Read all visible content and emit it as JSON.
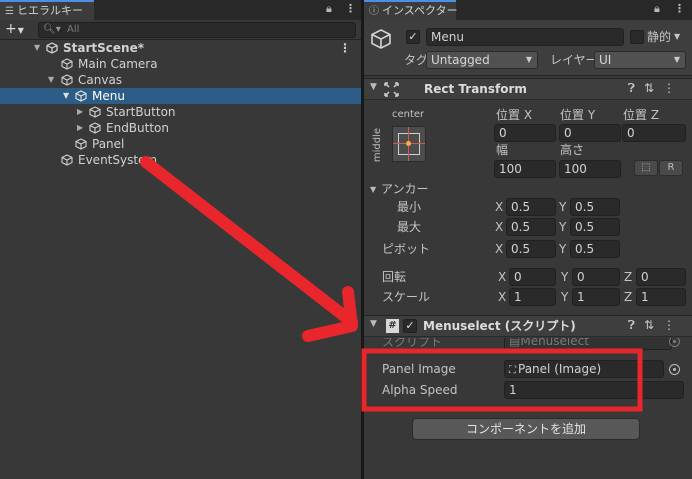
{
  "hierarchy": {
    "tab_label": "ヒエラルキー",
    "search_placeholder": "All",
    "add_label": "+",
    "items": [
      {
        "label": "StartScene*"
      },
      {
        "label": "Main Camera"
      },
      {
        "label": "Canvas"
      },
      {
        "label": "Menu"
      },
      {
        "label": "StartButton"
      },
      {
        "label": "EndButton"
      },
      {
        "label": "Panel"
      },
      {
        "label": "EventSystem"
      }
    ]
  },
  "inspector": {
    "tab_label": "インスペクター",
    "object": {
      "name": "Menu",
      "static_label": "静的",
      "tag_label": "タグ",
      "tag_value": "Untagged",
      "layer_label": "レイヤー",
      "layer_value": "UI"
    },
    "rect_transform": {
      "title": "Rect Transform",
      "anchor_h_label": "center",
      "anchor_v_label": "middle",
      "pos_x_label": "位置 X",
      "pos_y_label": "位置 Y",
      "pos_z_label": "位置 Z",
      "pos_x": "0",
      "pos_y": "0",
      "pos_z": "0",
      "width_label": "幅",
      "height_label": "高さ",
      "width": "100",
      "height": "100",
      "raw_button": "R",
      "anchors_label": "アンカー",
      "min_label": "最小",
      "max_label": "最大",
      "min_x": "0.5",
      "min_y": "0.5",
      "max_x": "0.5",
      "max_y": "0.5",
      "pivot_label": "ピボット",
      "pivot_x": "0.5",
      "pivot_y": "0.5",
      "rotation_label": "回転",
      "rot_x": "0",
      "rot_y": "0",
      "rot_z": "0",
      "scale_label": "スケール",
      "scale_x": "1",
      "scale_y": "1",
      "scale_z": "1",
      "x": "X",
      "y": "Y",
      "z": "Z"
    },
    "menuselect": {
      "title": "Menuselect (スクリプト)",
      "script_label": "スクリプト",
      "script_value": "Menuselect",
      "panel_image_label": "Panel Image",
      "panel_image_value": "Panel (Image)",
      "alpha_speed_label": "Alpha Speed",
      "alpha_speed_value": "1"
    },
    "add_component": "コンポーネントを追加"
  },
  "colors": {
    "annotation_red": "#e8262c",
    "selection_blue": "#2c5d87",
    "panel_bg": "#383838"
  }
}
